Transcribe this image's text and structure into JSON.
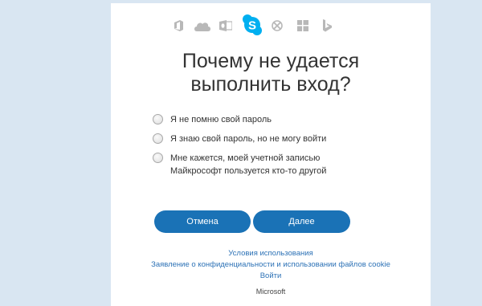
{
  "header": {
    "icons": [
      "office-icon",
      "onedrive-icon",
      "outlook-icon",
      "skype-icon",
      "xbox-icon",
      "windows-icon",
      "bing-icon"
    ],
    "skype_color": "#00aff0",
    "icon_color": "#b8b8b8"
  },
  "title_line1": "Почему не удается",
  "title_line2": "выполнить вход?",
  "options": [
    {
      "label": "Я не помню свой пароль"
    },
    {
      "label": "Я знаю свой пароль, но не могу войти"
    },
    {
      "label": "Мне кажется, моей учетной записью\nМайкрософт пользуется кто-то другой"
    }
  ],
  "buttons": {
    "cancel": "Отмена",
    "next": "Далее",
    "color": "#1a72b6"
  },
  "links": {
    "terms": "Условия использования",
    "privacy": "Заявление о конфиденциальности и использовании файлов cookie",
    "signin": "Войти"
  },
  "footer": {
    "brand": "Microsoft"
  }
}
